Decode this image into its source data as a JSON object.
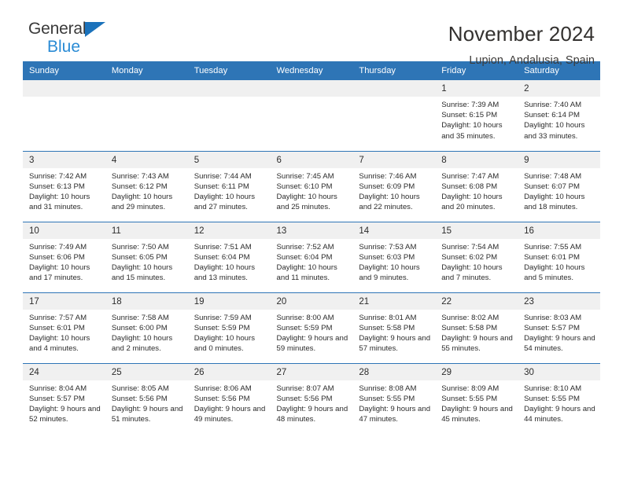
{
  "brand": {
    "name_part1": "General",
    "name_part2": "Blue",
    "triangle_color": "#1b72bb",
    "blue_text_color": "#2a8bd5"
  },
  "header": {
    "title": "November 2024",
    "subtitle": "Lupion, Andalusia, Spain"
  },
  "theme": {
    "header_bar_color": "#2e75b6",
    "daynum_band_color": "#f0f0f0",
    "text_color": "#2b2b2b"
  },
  "weekdays": [
    "Sunday",
    "Monday",
    "Tuesday",
    "Wednesday",
    "Thursday",
    "Friday",
    "Saturday"
  ],
  "labels": {
    "sunrise_prefix": "Sunrise:",
    "sunset_prefix": "Sunset:",
    "daylight_prefix": "Daylight:"
  },
  "weeks": [
    [
      {
        "day": "",
        "empty": true
      },
      {
        "day": "",
        "empty": true
      },
      {
        "day": "",
        "empty": true
      },
      {
        "day": "",
        "empty": true
      },
      {
        "day": "",
        "empty": true
      },
      {
        "day": "1",
        "sunrise": "Sunrise: 7:39 AM",
        "sunset": "Sunset: 6:15 PM",
        "daylight": "Daylight: 10 hours and 35 minutes."
      },
      {
        "day": "2",
        "sunrise": "Sunrise: 7:40 AM",
        "sunset": "Sunset: 6:14 PM",
        "daylight": "Daylight: 10 hours and 33 minutes."
      }
    ],
    [
      {
        "day": "3",
        "sunrise": "Sunrise: 7:42 AM",
        "sunset": "Sunset: 6:13 PM",
        "daylight": "Daylight: 10 hours and 31 minutes."
      },
      {
        "day": "4",
        "sunrise": "Sunrise: 7:43 AM",
        "sunset": "Sunset: 6:12 PM",
        "daylight": "Daylight: 10 hours and 29 minutes."
      },
      {
        "day": "5",
        "sunrise": "Sunrise: 7:44 AM",
        "sunset": "Sunset: 6:11 PM",
        "daylight": "Daylight: 10 hours and 27 minutes."
      },
      {
        "day": "6",
        "sunrise": "Sunrise: 7:45 AM",
        "sunset": "Sunset: 6:10 PM",
        "daylight": "Daylight: 10 hours and 25 minutes."
      },
      {
        "day": "7",
        "sunrise": "Sunrise: 7:46 AM",
        "sunset": "Sunset: 6:09 PM",
        "daylight": "Daylight: 10 hours and 22 minutes."
      },
      {
        "day": "8",
        "sunrise": "Sunrise: 7:47 AM",
        "sunset": "Sunset: 6:08 PM",
        "daylight": "Daylight: 10 hours and 20 minutes."
      },
      {
        "day": "9",
        "sunrise": "Sunrise: 7:48 AM",
        "sunset": "Sunset: 6:07 PM",
        "daylight": "Daylight: 10 hours and 18 minutes."
      }
    ],
    [
      {
        "day": "10",
        "sunrise": "Sunrise: 7:49 AM",
        "sunset": "Sunset: 6:06 PM",
        "daylight": "Daylight: 10 hours and 17 minutes."
      },
      {
        "day": "11",
        "sunrise": "Sunrise: 7:50 AM",
        "sunset": "Sunset: 6:05 PM",
        "daylight": "Daylight: 10 hours and 15 minutes."
      },
      {
        "day": "12",
        "sunrise": "Sunrise: 7:51 AM",
        "sunset": "Sunset: 6:04 PM",
        "daylight": "Daylight: 10 hours and 13 minutes."
      },
      {
        "day": "13",
        "sunrise": "Sunrise: 7:52 AM",
        "sunset": "Sunset: 6:04 PM",
        "daylight": "Daylight: 10 hours and 11 minutes."
      },
      {
        "day": "14",
        "sunrise": "Sunrise: 7:53 AM",
        "sunset": "Sunset: 6:03 PM",
        "daylight": "Daylight: 10 hours and 9 minutes."
      },
      {
        "day": "15",
        "sunrise": "Sunrise: 7:54 AM",
        "sunset": "Sunset: 6:02 PM",
        "daylight": "Daylight: 10 hours and 7 minutes."
      },
      {
        "day": "16",
        "sunrise": "Sunrise: 7:55 AM",
        "sunset": "Sunset: 6:01 PM",
        "daylight": "Daylight: 10 hours and 5 minutes."
      }
    ],
    [
      {
        "day": "17",
        "sunrise": "Sunrise: 7:57 AM",
        "sunset": "Sunset: 6:01 PM",
        "daylight": "Daylight: 10 hours and 4 minutes."
      },
      {
        "day": "18",
        "sunrise": "Sunrise: 7:58 AM",
        "sunset": "Sunset: 6:00 PM",
        "daylight": "Daylight: 10 hours and 2 minutes."
      },
      {
        "day": "19",
        "sunrise": "Sunrise: 7:59 AM",
        "sunset": "Sunset: 5:59 PM",
        "daylight": "Daylight: 10 hours and 0 minutes."
      },
      {
        "day": "20",
        "sunrise": "Sunrise: 8:00 AM",
        "sunset": "Sunset: 5:59 PM",
        "daylight": "Daylight: 9 hours and 59 minutes."
      },
      {
        "day": "21",
        "sunrise": "Sunrise: 8:01 AM",
        "sunset": "Sunset: 5:58 PM",
        "daylight": "Daylight: 9 hours and 57 minutes."
      },
      {
        "day": "22",
        "sunrise": "Sunrise: 8:02 AM",
        "sunset": "Sunset: 5:58 PM",
        "daylight": "Daylight: 9 hours and 55 minutes."
      },
      {
        "day": "23",
        "sunrise": "Sunrise: 8:03 AM",
        "sunset": "Sunset: 5:57 PM",
        "daylight": "Daylight: 9 hours and 54 minutes."
      }
    ],
    [
      {
        "day": "24",
        "sunrise": "Sunrise: 8:04 AM",
        "sunset": "Sunset: 5:57 PM",
        "daylight": "Daylight: 9 hours and 52 minutes."
      },
      {
        "day": "25",
        "sunrise": "Sunrise: 8:05 AM",
        "sunset": "Sunset: 5:56 PM",
        "daylight": "Daylight: 9 hours and 51 minutes."
      },
      {
        "day": "26",
        "sunrise": "Sunrise: 8:06 AM",
        "sunset": "Sunset: 5:56 PM",
        "daylight": "Daylight: 9 hours and 49 minutes."
      },
      {
        "day": "27",
        "sunrise": "Sunrise: 8:07 AM",
        "sunset": "Sunset: 5:56 PM",
        "daylight": "Daylight: 9 hours and 48 minutes."
      },
      {
        "day": "28",
        "sunrise": "Sunrise: 8:08 AM",
        "sunset": "Sunset: 5:55 PM",
        "daylight": "Daylight: 9 hours and 47 minutes."
      },
      {
        "day": "29",
        "sunrise": "Sunrise: 8:09 AM",
        "sunset": "Sunset: 5:55 PM",
        "daylight": "Daylight: 9 hours and 45 minutes."
      },
      {
        "day": "30",
        "sunrise": "Sunrise: 8:10 AM",
        "sunset": "Sunset: 5:55 PM",
        "daylight": "Daylight: 9 hours and 44 minutes."
      }
    ]
  ]
}
